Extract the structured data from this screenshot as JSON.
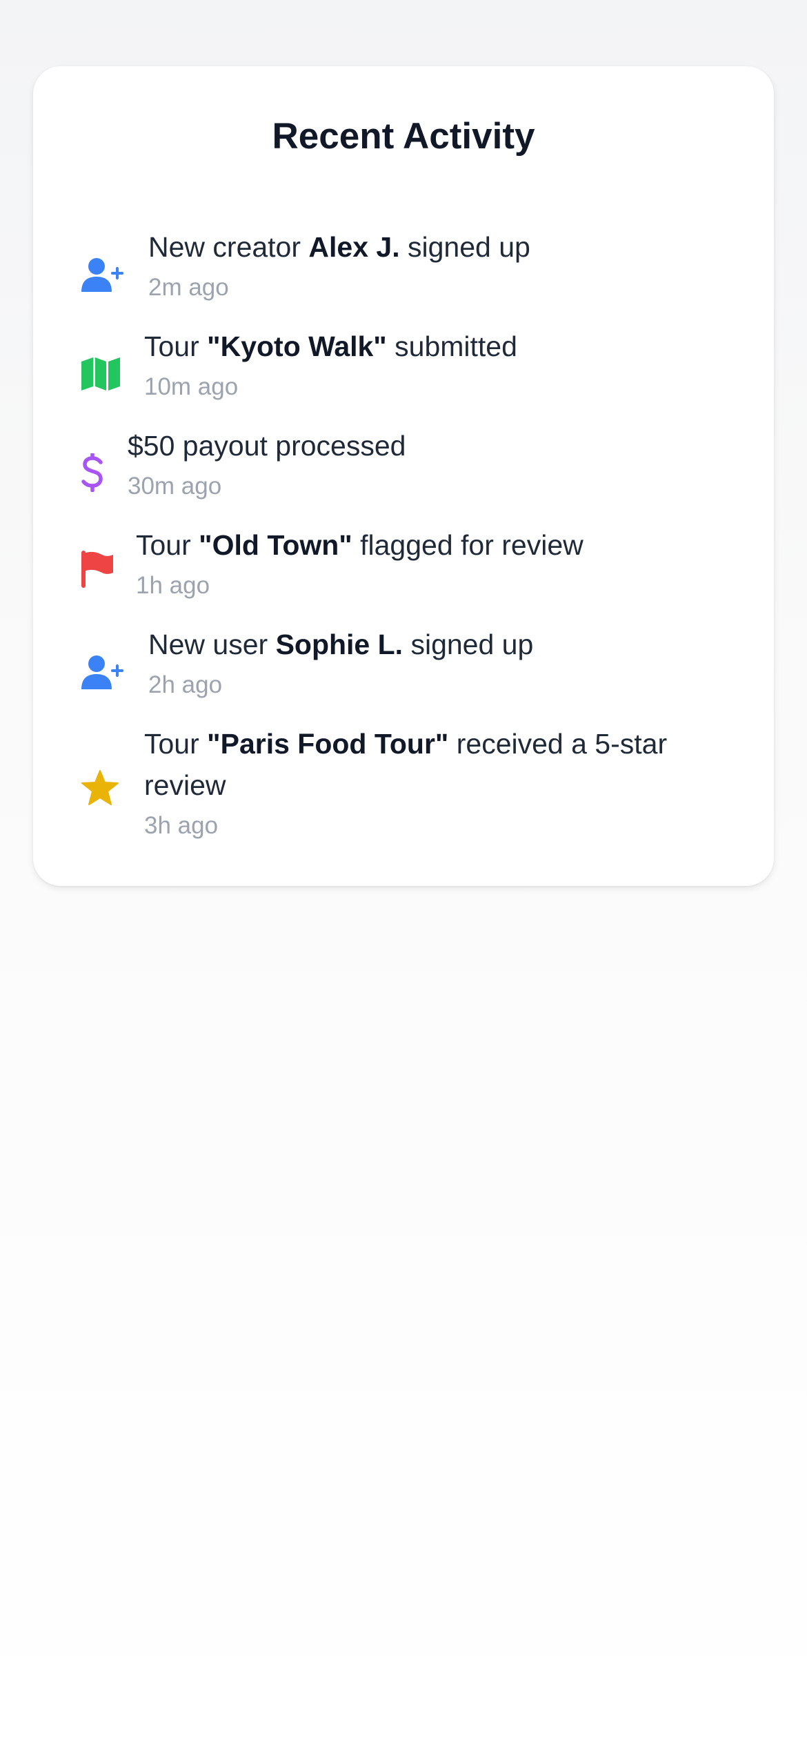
{
  "card": {
    "title": "Recent Activity"
  },
  "activities": [
    {
      "icon": "user-plus-icon",
      "icon_color": "#3b82f6",
      "prefix": "New creator ",
      "highlight": "Alex J.",
      "suffix": " signed up",
      "time": "2m ago"
    },
    {
      "icon": "map-icon",
      "icon_color": "#22c55e",
      "prefix": "Tour ",
      "highlight": "\"Kyoto Walk\"",
      "suffix": " submitted",
      "time": "10m ago"
    },
    {
      "icon": "dollar-icon",
      "icon_color": "#a855f7",
      "prefix": "$50 payout processed",
      "highlight": "",
      "suffix": "",
      "time": "30m ago"
    },
    {
      "icon": "flag-icon",
      "icon_color": "#ef4444",
      "prefix": "Tour ",
      "highlight": "\"Old Town\"",
      "suffix": " flagged for review",
      "time": "1h ago"
    },
    {
      "icon": "user-plus-icon",
      "icon_color": "#3b82f6",
      "prefix": "New user ",
      "highlight": "Sophie L.",
      "suffix": " signed up",
      "time": "2h ago"
    },
    {
      "icon": "star-icon",
      "icon_color": "#eab308",
      "prefix": "Tour ",
      "highlight": "\"Paris Food Tour\"",
      "suffix": " received a 5-star review",
      "time": "3h ago"
    }
  ]
}
